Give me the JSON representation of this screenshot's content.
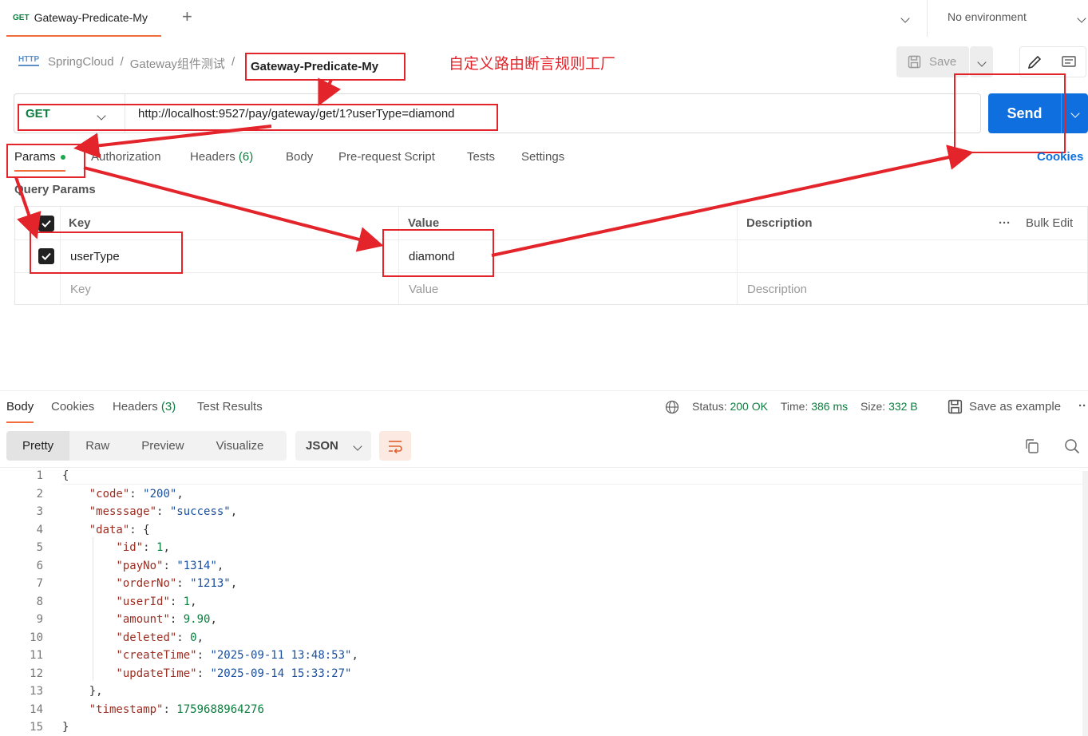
{
  "tab": {
    "method": "GET",
    "title": "Gateway-Predicate-My"
  },
  "environment": "No environment",
  "breadcrumb": {
    "root": "SpringCloud",
    "sep": "/",
    "folder": "Gateway组件测试",
    "current": "Gateway-Predicate-My"
  },
  "annotation": "自定义路由断言规则工厂",
  "save_label": "Save",
  "request": {
    "method": "GET",
    "url": "http://localhost:9527/pay/gateway/get/1?userType=diamond",
    "send_label": "Send"
  },
  "req_tabs": {
    "params": "Params",
    "authorization": "Authorization",
    "headers": "Headers",
    "headers_count": "(6)",
    "body": "Body",
    "prerequest": "Pre-request Script",
    "tests": "Tests",
    "settings": "Settings",
    "cookies": "Cookies"
  },
  "query_params": {
    "title": "Query Params",
    "headers": {
      "key": "Key",
      "value": "Value",
      "description": "Description",
      "bulk_edit": "Bulk Edit"
    },
    "row": {
      "key": "userType",
      "value": "diamond"
    },
    "placeholders": {
      "key": "Key",
      "value": "Value",
      "description": "Description"
    }
  },
  "resp_tabs": {
    "body": "Body",
    "cookies": "Cookies",
    "headers": "Headers",
    "headers_count": "(3)",
    "test_results": "Test Results"
  },
  "status": {
    "label": "Status:",
    "value": "200 OK",
    "time_label": "Time:",
    "time": "386 ms",
    "size_label": "Size:",
    "size": "332 B",
    "save_example": "Save as example"
  },
  "view_modes": {
    "pretty": "Pretty",
    "raw": "Raw",
    "preview": "Preview",
    "visualize": "Visualize",
    "format": "JSON"
  },
  "line_numbers": [
    "1",
    "2",
    "3",
    "4",
    "5",
    "6",
    "7",
    "8",
    "9",
    "10",
    "11",
    "12",
    "13",
    "14",
    "15"
  ],
  "response": {
    "code_key": "\"code\"",
    "code_val": "\"200\"",
    "msg_key": "\"messsage\"",
    "msg_val": "\"success\"",
    "data_key": "\"data\"",
    "id_key": "\"id\"",
    "id_val": "1",
    "payno_key": "\"payNo\"",
    "payno_val": "\"1314\"",
    "orderno_key": "\"orderNo\"",
    "orderno_val": "\"1213\"",
    "userid_key": "\"userId\"",
    "userid_val": "1",
    "amount_key": "\"amount\"",
    "amount_val": "9.90",
    "deleted_key": "\"deleted\"",
    "deleted_val": "0",
    "create_key": "\"createTime\"",
    "create_val": "\"2025-09-11 13:48:53\"",
    "update_key": "\"updateTime\"",
    "update_val": "\"2025-09-14 15:33:27\"",
    "ts_key": "\"timestamp\"",
    "ts_val": "1759688964276"
  },
  "colors": {
    "accent": "#f26b3a",
    "send": "#0f6fde",
    "annotation": "#e3242b",
    "get": "#0b7d3e"
  }
}
